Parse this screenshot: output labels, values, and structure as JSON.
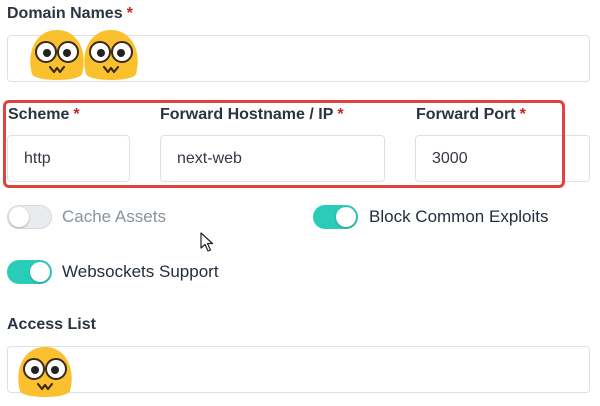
{
  "domain_names": {
    "label": "Domain Names",
    "required_marker": "*",
    "tokens": [
      "emoji-face",
      "emoji-face"
    ]
  },
  "scheme": {
    "label": "Scheme",
    "required_marker": "*",
    "value": "http"
  },
  "forward_hostname": {
    "label": "Forward Hostname / IP",
    "required_marker": "*",
    "value": "next-web"
  },
  "forward_port": {
    "label": "Forward Port",
    "required_marker": "*",
    "value": "3000"
  },
  "toggles": {
    "cache_assets": {
      "label": "Cache Assets",
      "enabled": false
    },
    "block_common_exploits": {
      "label": "Block Common Exploits",
      "enabled": true
    },
    "websockets_support": {
      "label": "Websockets Support",
      "enabled": true
    }
  },
  "access_list": {
    "label": "Access List",
    "tokens": [
      "emoji-face"
    ]
  },
  "colors": {
    "required": "#cd201f",
    "toggle_on": "#2bcbba",
    "highlight_box": "#e0433f"
  }
}
